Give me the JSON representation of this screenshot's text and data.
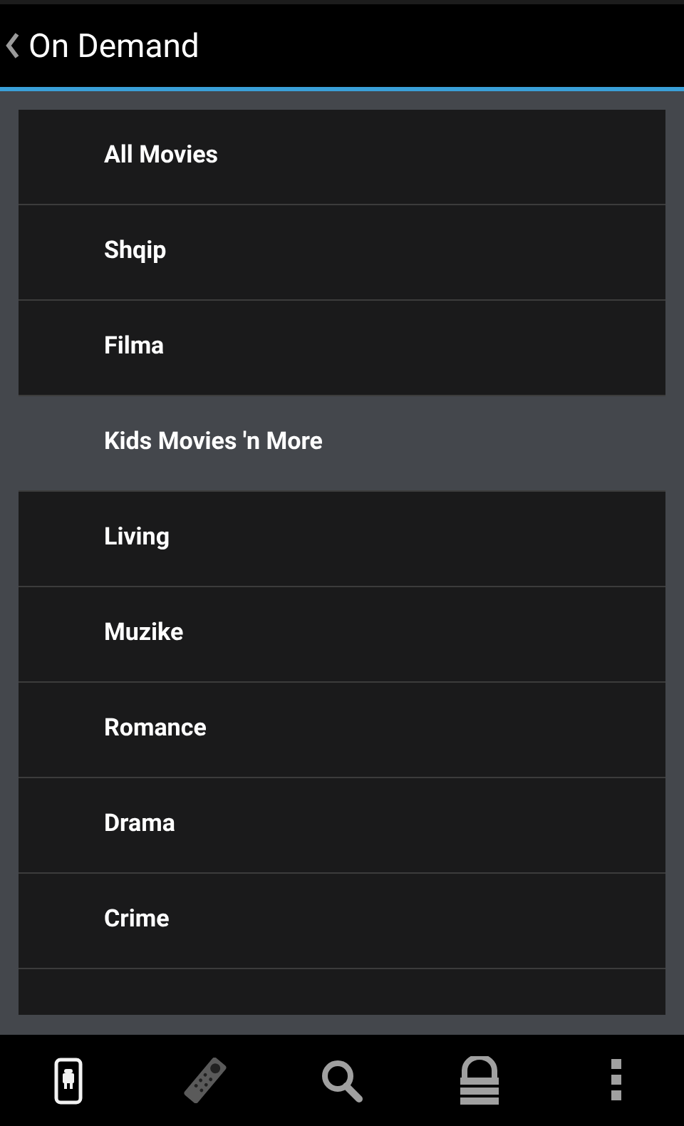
{
  "action_bar": {
    "title": "On Demand"
  },
  "categories": [
    {
      "label": "All Movies",
      "selected": false
    },
    {
      "label": "Shqip",
      "selected": false
    },
    {
      "label": "Filma",
      "selected": false
    },
    {
      "label": "Kids Movies 'n More",
      "selected": true
    },
    {
      "label": "Living",
      "selected": false
    },
    {
      "label": "Muzike",
      "selected": false
    },
    {
      "label": "Romance",
      "selected": false
    },
    {
      "label": "Drama",
      "selected": false
    },
    {
      "label": "Crime",
      "selected": false
    }
  ],
  "bottom_bar": [
    {
      "kind": "device",
      "selected": true,
      "disabled": false
    },
    {
      "kind": "remote",
      "selected": false,
      "disabled": true
    },
    {
      "kind": "search",
      "selected": false,
      "disabled": false
    },
    {
      "kind": "lock",
      "selected": false,
      "disabled": false
    },
    {
      "kind": "overflow",
      "selected": false,
      "disabled": false
    }
  ]
}
